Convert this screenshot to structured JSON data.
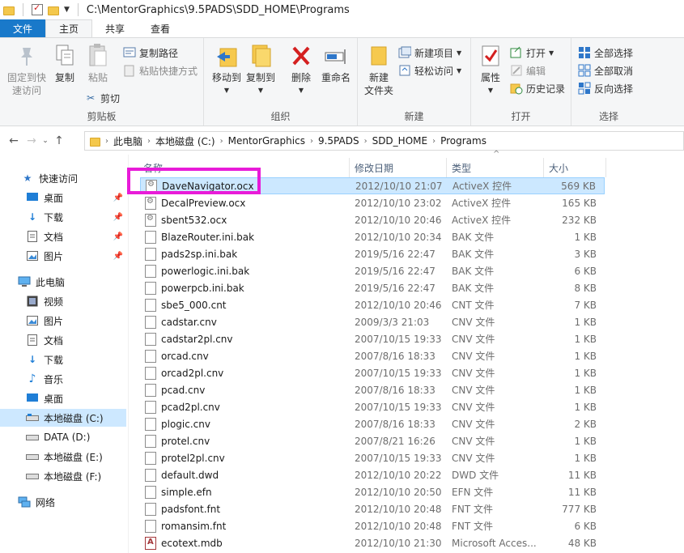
{
  "window": {
    "title": "C:\\MentorGraphics\\9.5PADS\\SDD_HOME\\Programs"
  },
  "ribbon_tabs": [
    {
      "label": "文件"
    },
    {
      "label": "主页"
    },
    {
      "label": "共享"
    },
    {
      "label": "查看"
    }
  ],
  "ribbon": {
    "clipboard": {
      "label": "剪贴板",
      "pin_quick": "固定到快\n速访问",
      "copy": "复制",
      "paste": "粘贴",
      "copy_path": "复制路径",
      "paste_shortcut": "粘贴快捷方式",
      "cut": "剪切"
    },
    "organize": {
      "label": "组织",
      "move_to": "移动到",
      "copy_to": "复制到",
      "delete": "删除",
      "rename": "重命名"
    },
    "new": {
      "label": "新建",
      "new_folder": "新建\n文件夹",
      "new_item": "新建项目",
      "easy_access": "轻松访问"
    },
    "open": {
      "label": "打开",
      "properties": "属性",
      "open": "打开",
      "edit": "编辑",
      "history": "历史记录"
    },
    "select": {
      "label": "选择",
      "select_all": "全部选择",
      "select_none": "全部取消",
      "invert": "反向选择"
    }
  },
  "address": {
    "crumbs": [
      "此电脑",
      "本地磁盘 (C:)",
      "MentorGraphics",
      "9.5PADS",
      "SDD_HOME",
      "Programs"
    ]
  },
  "sidebar": {
    "items": [
      {
        "label": "快速访问",
        "icon": "star-icon",
        "pinned": false
      },
      {
        "label": "桌面",
        "icon": "desktop-icon",
        "pinned": true
      },
      {
        "label": "下载",
        "icon": "download-icon",
        "pinned": true
      },
      {
        "label": "文档",
        "icon": "document-icon",
        "pinned": true
      },
      {
        "label": "图片",
        "icon": "picture-icon",
        "pinned": true
      },
      {
        "label": "此电脑",
        "icon": "computer-icon",
        "pinned": false
      },
      {
        "label": "视频",
        "icon": "video-icon",
        "pinned": false
      },
      {
        "label": "图片",
        "icon": "picture-icon",
        "pinned": false
      },
      {
        "label": "文档",
        "icon": "document-icon",
        "pinned": false
      },
      {
        "label": "下载",
        "icon": "download-icon",
        "pinned": false
      },
      {
        "label": "音乐",
        "icon": "music-icon",
        "pinned": false
      },
      {
        "label": "桌面",
        "icon": "desktop-icon",
        "pinned": false
      },
      {
        "label": "本地磁盘 (C:)",
        "icon": "drive-icon",
        "pinned": false
      },
      {
        "label": "DATA (D:)",
        "icon": "drive-icon",
        "pinned": false
      },
      {
        "label": "本地磁盘 (E:)",
        "icon": "drive-icon",
        "pinned": false
      },
      {
        "label": "本地磁盘 (F:)",
        "icon": "drive-icon",
        "pinned": false
      },
      {
        "label": "网络",
        "icon": "network-icon",
        "pinned": false
      }
    ]
  },
  "columns": {
    "name": "名称",
    "date": "修改日期",
    "type": "类型",
    "size": "大小"
  },
  "files": [
    {
      "name": "DaveNavigator.ocx",
      "date": "2012/10/10 21:07",
      "type": "ActiveX 控件",
      "size": "569 KB",
      "icon": "activex-icon"
    },
    {
      "name": "DecalPreview.ocx",
      "date": "2012/10/10 23:02",
      "type": "ActiveX 控件",
      "size": "165 KB",
      "icon": "activex-icon"
    },
    {
      "name": "sbent532.ocx",
      "date": "2012/10/10 20:46",
      "type": "ActiveX 控件",
      "size": "232 KB",
      "icon": "activex-icon"
    },
    {
      "name": "BlazeRouter.ini.bak",
      "date": "2012/10/10 20:34",
      "type": "BAK 文件",
      "size": "1 KB",
      "icon": "file-icon"
    },
    {
      "name": "pads2sp.ini.bak",
      "date": "2019/5/16 22:47",
      "type": "BAK 文件",
      "size": "3 KB",
      "icon": "file-icon"
    },
    {
      "name": "powerlogic.ini.bak",
      "date": "2019/5/16 22:47",
      "type": "BAK 文件",
      "size": "6 KB",
      "icon": "file-icon"
    },
    {
      "name": "powerpcb.ini.bak",
      "date": "2019/5/16 22:47",
      "type": "BAK 文件",
      "size": "8 KB",
      "icon": "file-icon"
    },
    {
      "name": "sbe5_000.cnt",
      "date": "2012/10/10 20:46",
      "type": "CNT 文件",
      "size": "7 KB",
      "icon": "file-icon"
    },
    {
      "name": "cadstar.cnv",
      "date": "2009/3/3 21:03",
      "type": "CNV 文件",
      "size": "1 KB",
      "icon": "file-icon"
    },
    {
      "name": "cadstar2pl.cnv",
      "date": "2007/10/15 19:33",
      "type": "CNV 文件",
      "size": "1 KB",
      "icon": "file-icon"
    },
    {
      "name": "orcad.cnv",
      "date": "2007/8/16 18:33",
      "type": "CNV 文件",
      "size": "1 KB",
      "icon": "file-icon"
    },
    {
      "name": "orcad2pl.cnv",
      "date": "2007/10/15 19:33",
      "type": "CNV 文件",
      "size": "1 KB",
      "icon": "file-icon"
    },
    {
      "name": "pcad.cnv",
      "date": "2007/8/16 18:33",
      "type": "CNV 文件",
      "size": "1 KB",
      "icon": "file-icon"
    },
    {
      "name": "pcad2pl.cnv",
      "date": "2007/10/15 19:33",
      "type": "CNV 文件",
      "size": "1 KB",
      "icon": "file-icon"
    },
    {
      "name": "plogic.cnv",
      "date": "2007/8/16 18:33",
      "type": "CNV 文件",
      "size": "2 KB",
      "icon": "file-icon"
    },
    {
      "name": "protel.cnv",
      "date": "2007/8/21 16:26",
      "type": "CNV 文件",
      "size": "1 KB",
      "icon": "file-icon"
    },
    {
      "name": "protel2pl.cnv",
      "date": "2007/10/15 19:33",
      "type": "CNV 文件",
      "size": "1 KB",
      "icon": "file-icon"
    },
    {
      "name": "default.dwd",
      "date": "2012/10/10 20:22",
      "type": "DWD 文件",
      "size": "11 KB",
      "icon": "file-icon"
    },
    {
      "name": "simple.efn",
      "date": "2012/10/10 20:50",
      "type": "EFN 文件",
      "size": "11 KB",
      "icon": "file-icon"
    },
    {
      "name": "padsfont.fnt",
      "date": "2012/10/10 20:48",
      "type": "FNT 文件",
      "size": "777 KB",
      "icon": "file-icon"
    },
    {
      "name": "romansim.fnt",
      "date": "2012/10/10 20:48",
      "type": "FNT 文件",
      "size": "6 KB",
      "icon": "file-icon"
    },
    {
      "name": "ecotext.mdb",
      "date": "2012/10/10 21:30",
      "type": "Microsoft Acces...",
      "size": "48 KB",
      "icon": "access-icon"
    }
  ],
  "colors": {
    "accent": "#1979ca",
    "selection": "#cce8ff",
    "highlight": "#e81bd8"
  }
}
